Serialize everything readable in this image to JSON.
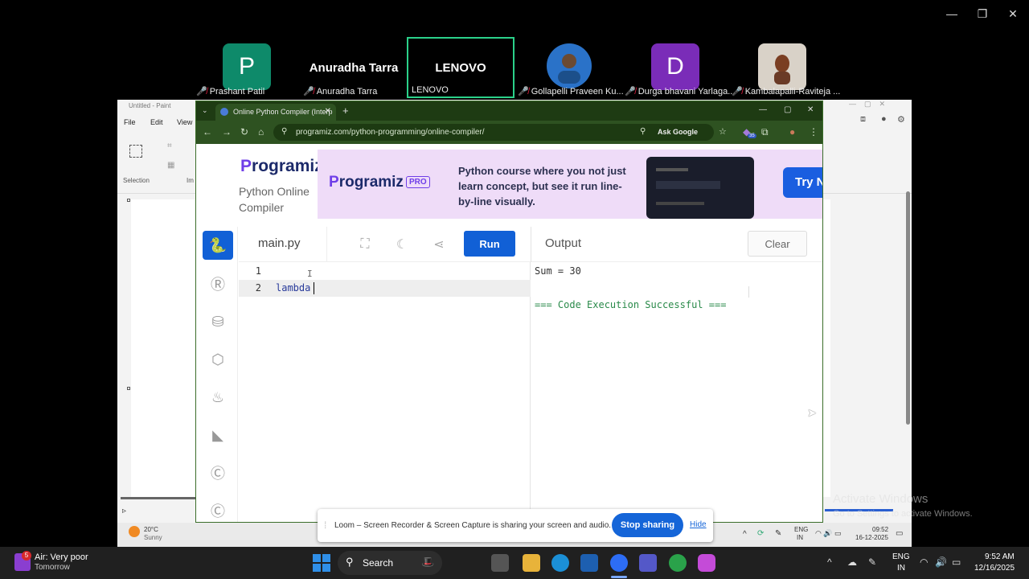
{
  "participants": [
    {
      "name": "Prashant Patil",
      "initial": "P",
      "color": "#0e8a6a",
      "type": "initial"
    },
    {
      "name": "Anuradha Tarra",
      "display": "Anuradha Tarra",
      "type": "name"
    },
    {
      "name": "LENOVO",
      "display": "LENOVO",
      "type": "active"
    },
    {
      "name": "Gollapelli Praveen Ku...",
      "type": "photo"
    },
    {
      "name": "Durga bhavani Yarlaga...",
      "initial": "D",
      "color": "#7a2cb8",
      "type": "initial"
    },
    {
      "name": "Kambalapalli-Raviteja ...",
      "type": "photo"
    }
  ],
  "paint": {
    "title": "Untitled - Paint",
    "menu": [
      "File",
      "Edit",
      "View"
    ],
    "selection_label": "Selection",
    "image_label": "Im"
  },
  "browser": {
    "tab_title": "Online Python Compiler (Interp",
    "url": "programiz.com/python-programming/online-compiler/",
    "ask_google": "Ask Google",
    "badge": "35"
  },
  "programiz": {
    "logo": "rogramiz",
    "logo_p": "P",
    "subtitle": "Python Online Compiler",
    "banner": {
      "logo": "rogramiz",
      "logo_p": "P",
      "pro": "PRO",
      "text": "Python course where you not just learn concept, but see it run line-by-line visually.",
      "try_label": "Try N"
    },
    "filename": "main.py",
    "run_label": "Run",
    "output_label": "Output",
    "clear_label": "Clear",
    "code_lines": [
      {
        "num": "1",
        "code": ""
      },
      {
        "num": "2",
        "code": "lambda"
      }
    ],
    "output_lines": [
      "Sum = 30",
      "",
      "=== Code Execution Successful ==="
    ]
  },
  "loom": {
    "message": "Loom – Screen Recorder & Screen Capture is sharing your screen and audio.",
    "stop_label": "Stop sharing",
    "hide_label": "Hide"
  },
  "inner_taskbar": {
    "temp": "20°C",
    "weather": "Sunny",
    "lang": "ENG",
    "lang2": "IN",
    "time": "09:52",
    "date": "16-12-2025"
  },
  "watermark": {
    "title": "Activate Windows",
    "subtitle": "Go to Settings to activate Windows."
  },
  "taskbar": {
    "weather_title": "Air: Very poor",
    "weather_sub": "Tomorrow",
    "weather_badge": "5",
    "search_label": "Search",
    "lang": "ENG",
    "lang2": "IN",
    "time": "9:52 AM",
    "date": "12/16/2025"
  }
}
